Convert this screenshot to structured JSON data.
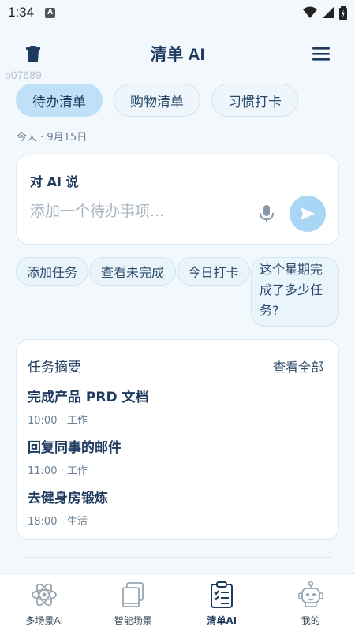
{
  "status": {
    "time": "1:34"
  },
  "header": {
    "title": "清单 AI"
  },
  "watermark": "b07689",
  "tabs": [
    {
      "label": "待办清单",
      "active": true
    },
    {
      "label": "购物清单",
      "active": false
    },
    {
      "label": "习惯打卡",
      "active": false
    }
  ],
  "date_text": "今天 · 9月15日",
  "ai_card": {
    "label": "对 AI 说",
    "placeholder": "添加一个待办事项..."
  },
  "chips": [
    "添加任务",
    "查看未完成",
    "今日打卡",
    "这个星期完成了多少任务?"
  ],
  "summary": {
    "title": "任务摘要",
    "view_all": "查看全部",
    "tasks": [
      {
        "name": "完成产品 PRD 文档",
        "meta": "10:00 · 工作"
      },
      {
        "name": "回复同事的邮件",
        "meta": "11:00 · 工作"
      },
      {
        "name": "去健身房锻炼",
        "meta": "18:00 · 生活"
      }
    ]
  },
  "nav": [
    {
      "label": "多场景AI",
      "icon": "atom-icon",
      "active": false
    },
    {
      "label": "智能场景",
      "icon": "cards-icon",
      "active": false
    },
    {
      "label": "清单AI",
      "icon": "clipboard-list-icon",
      "active": true
    },
    {
      "label": "我的",
      "icon": "robot-icon",
      "active": false
    }
  ],
  "colors": {
    "accent": "#bfe1f8",
    "send": "#a9d6f5",
    "text": "#1e3a5f",
    "background": "#f3f8fc"
  }
}
